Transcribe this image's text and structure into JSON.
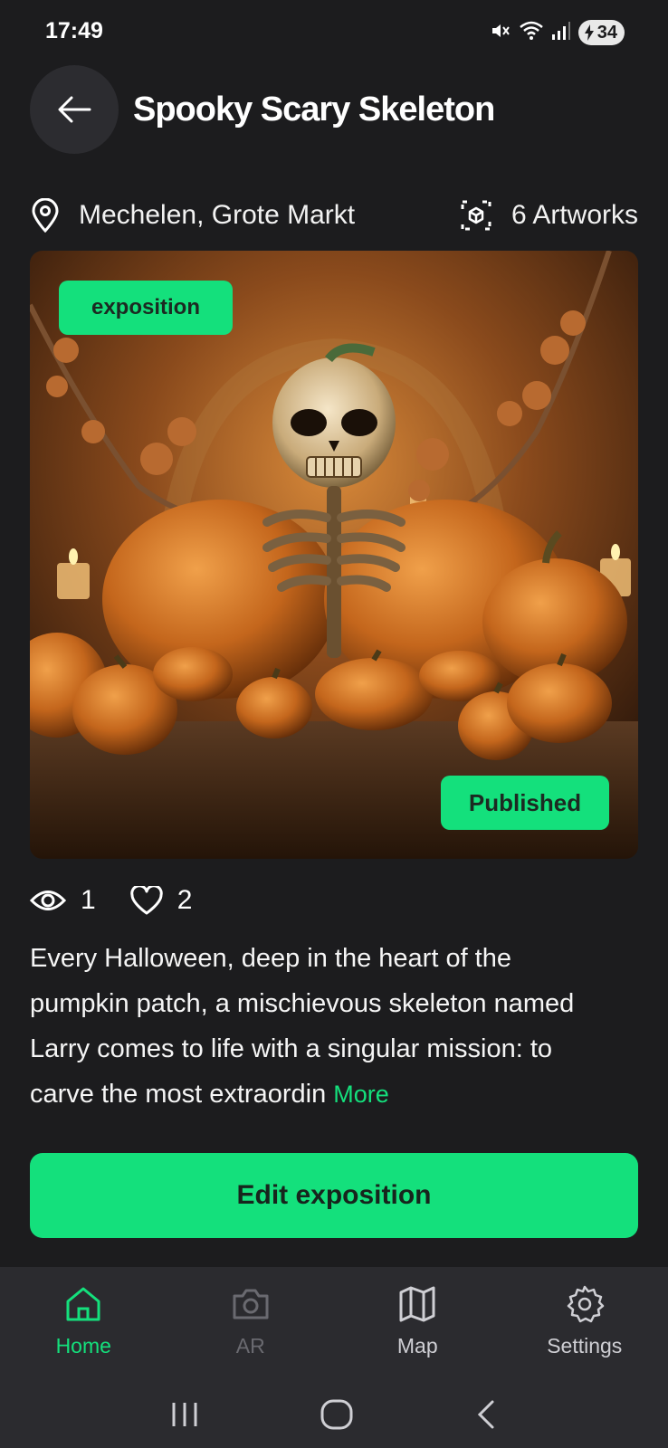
{
  "status_bar": {
    "time": "17:49",
    "battery": "34"
  },
  "header": {
    "title": "Spooky Scary Skeleton"
  },
  "meta": {
    "location": "Mechelen, Grote Markt",
    "artworks": "6 Artworks"
  },
  "hero": {
    "type_tag": "exposition",
    "status_tag": "Published"
  },
  "stats": {
    "views": "1",
    "likes": "2"
  },
  "description": {
    "text": "Every Halloween, deep in the heart of the pumpkin patch, a mischievous skeleton named Larry comes to life with a singular mission: to carve the most extraordin",
    "more_label": "More"
  },
  "actions": {
    "edit_label": "Edit exposition"
  },
  "bottom_nav": {
    "items": [
      {
        "label": "Home",
        "icon": "home-icon"
      },
      {
        "label": "AR",
        "icon": "camera-icon"
      },
      {
        "label": "Map",
        "icon": "map-icon"
      },
      {
        "label": "Settings",
        "icon": "gear-icon"
      }
    ]
  },
  "colors": {
    "accent": "#14e07c",
    "background": "#1c1c1e",
    "nav_background": "#2b2b2f"
  }
}
